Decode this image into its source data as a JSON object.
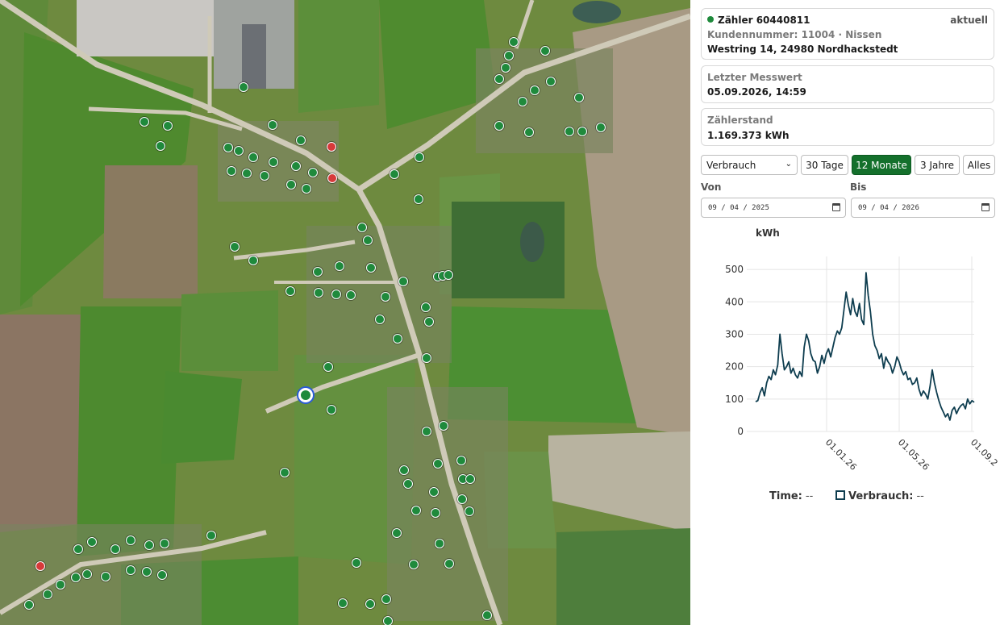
{
  "meter": {
    "title": "Zähler 60440811",
    "status": "aktuell",
    "customer_line": "Kundennummer: 11004 · Nissen",
    "address": "Westring 14, 24980 Nordhackstedt"
  },
  "last_reading": {
    "label": "Letzter Messwert",
    "value": "05.09.2026, 14:59"
  },
  "counter": {
    "label": "Zählerstand",
    "value": "1.169.373 kWh"
  },
  "controls": {
    "metric_select": "Verbrauch",
    "ranges": [
      "30 Tage",
      "12 Monate",
      "3 Jahre",
      "Alles"
    ],
    "active_range": "12 Monate"
  },
  "dates": {
    "from_label": "Von",
    "from_value": "09 / 04 / 2025",
    "to_label": "Bis",
    "to_value": "09 / 04 / 2026"
  },
  "legend": {
    "time_label": "Time:",
    "time_value": "--",
    "series_label": "Verbrauch:",
    "series_value": "--"
  },
  "colors": {
    "marker_ok": "#1f8a3c",
    "marker_alert": "#d73a3a",
    "selected_ring": "#2a5bd7",
    "accent_button": "#14702c",
    "chart_line": "#0e3d4f"
  },
  "chart_data": {
    "type": "line",
    "ylabel": "kWh",
    "yticks": [
      0,
      100,
      200,
      300,
      400,
      500
    ],
    "xtick_labels": [
      "01.01.26",
      "01.05.26",
      "01.09.2"
    ],
    "x_start": "2025-09-04",
    "x_end": "2026-09-05",
    "series": [
      {
        "name": "Verbrauch",
        "values": [
          92,
          95,
          120,
          135,
          110,
          150,
          170,
          160,
          190,
          175,
          205,
          300,
          240,
          190,
          200,
          215,
          180,
          195,
          175,
          165,
          185,
          170,
          260,
          300,
          280,
          240,
          220,
          215,
          180,
          200,
          235,
          210,
          240,
          255,
          230,
          260,
          290,
          310,
          300,
          320,
          375,
          430,
          390,
          360,
          410,
          370,
          355,
          395,
          345,
          330,
          490,
          420,
          370,
          300,
          265,
          250,
          225,
          240,
          195,
          230,
          215,
          205,
          180,
          200,
          230,
          215,
          190,
          175,
          185,
          160,
          165,
          145,
          150,
          165,
          130,
          110,
          125,
          115,
          100,
          140,
          190,
          150,
          120,
          95,
          75,
          60,
          45,
          55,
          35,
          65,
          75,
          55,
          70,
          80,
          85,
          70,
          100,
          85,
          95,
          90
        ]
      }
    ]
  },
  "map_markers": [
    [
      302,
      108,
      "ok"
    ],
    [
      179,
      151,
      "ok"
    ],
    [
      208,
      156,
      "ok"
    ],
    [
      199,
      181,
      "ok"
    ],
    [
      338,
      155,
      "ok"
    ],
    [
      373,
      174,
      "ok"
    ],
    [
      411,
      182,
      "alert"
    ],
    [
      412,
      221,
      "alert"
    ],
    [
      283,
      183,
      "ok"
    ],
    [
      296,
      187,
      "ok"
    ],
    [
      314,
      195,
      "ok"
    ],
    [
      339,
      201,
      "ok"
    ],
    [
      287,
      212,
      "ok"
    ],
    [
      306,
      215,
      "ok"
    ],
    [
      328,
      218,
      "ok"
    ],
    [
      367,
      206,
      "ok"
    ],
    [
      388,
      214,
      "ok"
    ],
    [
      361,
      229,
      "ok"
    ],
    [
      380,
      234,
      "ok"
    ],
    [
      520,
      195,
      "ok"
    ],
    [
      489,
      216,
      "ok"
    ],
    [
      519,
      247,
      "ok"
    ],
    [
      637,
      52,
      "ok"
    ],
    [
      676,
      63,
      "ok"
    ],
    [
      631,
      69,
      "ok"
    ],
    [
      627,
      84,
      "ok"
    ],
    [
      619,
      98,
      "ok"
    ],
    [
      683,
      101,
      "ok"
    ],
    [
      663,
      112,
      "ok"
    ],
    [
      648,
      126,
      "ok"
    ],
    [
      718,
      121,
      "ok"
    ],
    [
      619,
      156,
      "ok"
    ],
    [
      656,
      164,
      "ok"
    ],
    [
      706,
      163,
      "ok"
    ],
    [
      722,
      163,
      "ok"
    ],
    [
      745,
      158,
      "ok"
    ],
    [
      449,
      282,
      "ok"
    ],
    [
      456,
      298,
      "ok"
    ],
    [
      291,
      306,
      "ok"
    ],
    [
      314,
      323,
      "ok"
    ],
    [
      421,
      330,
      "ok"
    ],
    [
      460,
      332,
      "ok"
    ],
    [
      394,
      337,
      "ok"
    ],
    [
      543,
      343,
      "ok"
    ],
    [
      549,
      342,
      "ok"
    ],
    [
      556,
      341,
      "ok"
    ],
    [
      500,
      349,
      "ok"
    ],
    [
      360,
      361,
      "ok"
    ],
    [
      395,
      363,
      "ok"
    ],
    [
      417,
      365,
      "ok"
    ],
    [
      435,
      366,
      "ok"
    ],
    [
      478,
      368,
      "ok"
    ],
    [
      528,
      381,
      "ok"
    ],
    [
      471,
      396,
      "ok"
    ],
    [
      532,
      399,
      "ok"
    ],
    [
      493,
      420,
      "ok"
    ],
    [
      529,
      444,
      "ok"
    ],
    [
      407,
      455,
      "ok"
    ],
    [
      411,
      508,
      "ok"
    ],
    [
      550,
      528,
      "ok"
    ],
    [
      529,
      535,
      "ok"
    ],
    [
      572,
      571,
      "ok"
    ],
    [
      543,
      575,
      "ok"
    ],
    [
      501,
      583,
      "ok"
    ],
    [
      574,
      594,
      "ok"
    ],
    [
      583,
      594,
      "ok"
    ],
    [
      353,
      586,
      "ok"
    ],
    [
      506,
      600,
      "ok"
    ],
    [
      538,
      610,
      "ok"
    ],
    [
      573,
      619,
      "ok"
    ],
    [
      582,
      634,
      "ok"
    ],
    [
      516,
      633,
      "ok"
    ],
    [
      540,
      636,
      "ok"
    ],
    [
      262,
      664,
      "ok"
    ],
    [
      492,
      661,
      "ok"
    ],
    [
      545,
      674,
      "ok"
    ],
    [
      114,
      672,
      "ok"
    ],
    [
      162,
      670,
      "ok"
    ],
    [
      185,
      676,
      "ok"
    ],
    [
      204,
      674,
      "ok"
    ],
    [
      97,
      681,
      "ok"
    ],
    [
      143,
      681,
      "ok"
    ],
    [
      442,
      698,
      "ok"
    ],
    [
      513,
      700,
      "ok"
    ],
    [
      557,
      699,
      "ok"
    ],
    [
      50,
      702,
      "alert"
    ],
    [
      162,
      707,
      "ok"
    ],
    [
      182,
      709,
      "ok"
    ],
    [
      108,
      712,
      "ok"
    ],
    [
      131,
      715,
      "ok"
    ],
    [
      94,
      716,
      "ok"
    ],
    [
      201,
      713,
      "ok"
    ],
    [
      75,
      725,
      "ok"
    ],
    [
      59,
      737,
      "ok"
    ],
    [
      36,
      750,
      "ok"
    ],
    [
      425,
      748,
      "ok"
    ],
    [
      459,
      749,
      "ok"
    ],
    [
      479,
      743,
      "ok"
    ],
    [
      481,
      770,
      "ok"
    ],
    [
      604,
      763,
      "ok"
    ]
  ],
  "selected_marker": [
    379,
    490
  ]
}
